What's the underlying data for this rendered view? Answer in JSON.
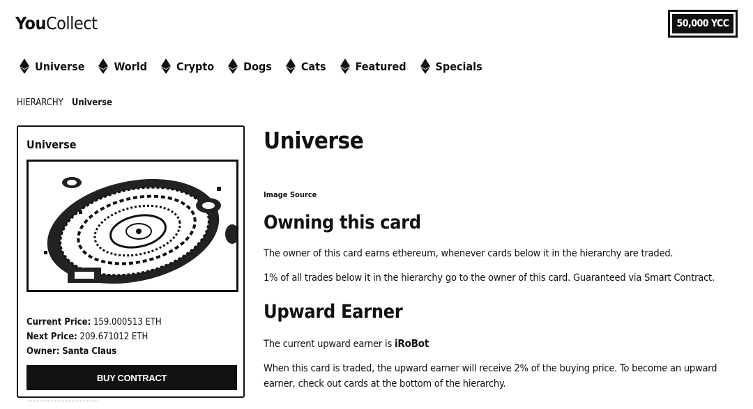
{
  "header": {
    "logo_bold": "You",
    "logo_rest": "Collect",
    "balance": "50,000 YCC"
  },
  "nav": [
    {
      "label": "Universe",
      "icon": "ethereum-icon"
    },
    {
      "label": "World",
      "icon": "ethereum-icon"
    },
    {
      "label": "Crypto",
      "icon": "ethereum-icon"
    },
    {
      "label": "Dogs",
      "icon": "ethereum-icon"
    },
    {
      "label": "Cats",
      "icon": "ethereum-icon"
    },
    {
      "label": "Featured",
      "icon": "ethereum-icon"
    },
    {
      "label": "Specials",
      "icon": "ethereum-icon"
    }
  ],
  "breadcrumb": {
    "root": "HIERARCHY",
    "current": "Universe"
  },
  "card": {
    "title": "Universe",
    "current_price_label": "Current Price:",
    "current_price_value": "159.000513 ETH",
    "next_price_label": "Next Price:",
    "next_price_value": "209.671012 ETH",
    "owner_label": "Owner:",
    "owner_value": "Santa Claus",
    "buy_label": "BUY CONTRACT"
  },
  "main": {
    "title": "Universe",
    "image_source": "Image Source",
    "owning_title": "Owning this card",
    "owning_p1": "The owner of this card earns ethereum, whenever cards below it in the hierarchy are traded.",
    "owning_p2": "1% of all trades below it in the hierarchy go to the owner of this card. Guaranteed via Smart Contract.",
    "upward_title": "Upward Earner",
    "upward_p1_prefix": "The current upward earner is",
    "upward_p1_name": "iRoBot",
    "upward_p2": "When this card is traded, the upward earner will receive 2% of the buying price. To become an upward earner, check out cards at the bottom of the hierarchy."
  },
  "colors": {
    "text": "#111111",
    "button_bg": "#111111",
    "button_text": "#ffffff"
  }
}
